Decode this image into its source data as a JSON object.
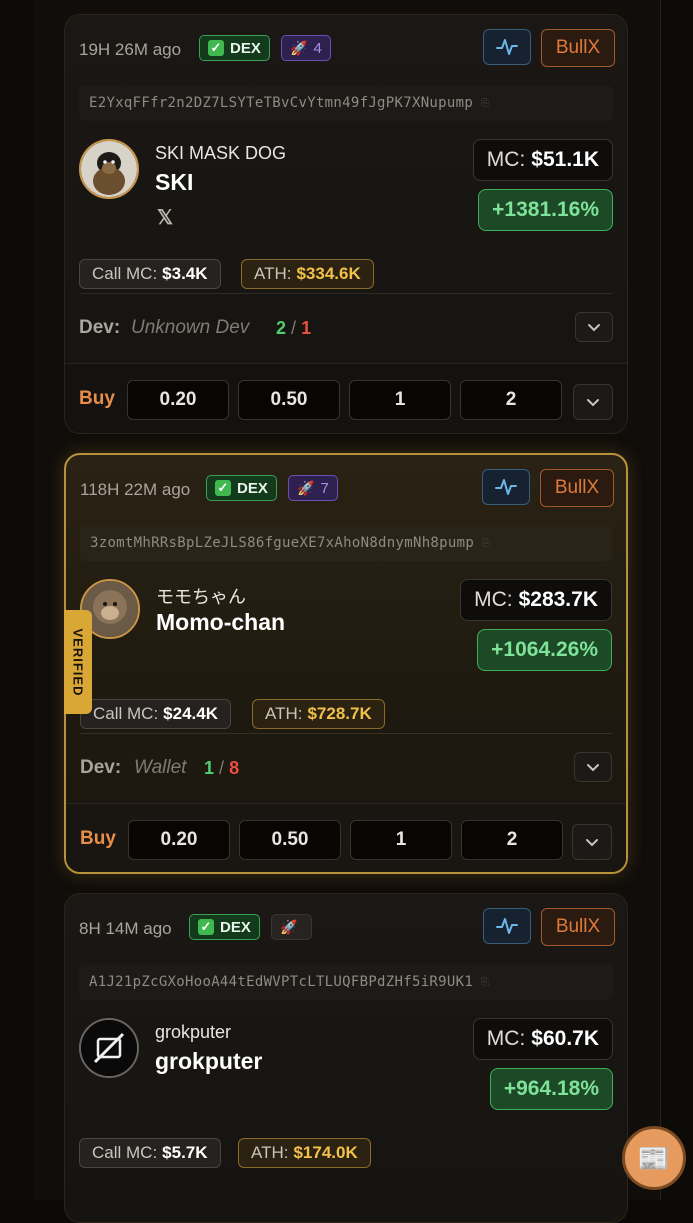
{
  "cards": [
    {
      "age": "19H 26M ago",
      "dex": "DEX",
      "rocket_count": "4",
      "bullx": "BullX",
      "address": "E2YxqFFfr2n2DZ7LSYTeTBvCvYtmn49fJgPK7XNupump",
      "name": "SKI MASK DOG",
      "symbol": "SKI",
      "mc_label": "MC:",
      "mc_value": "$51.1K",
      "change": "+1381.16%",
      "call_label": "Call MC:",
      "call_value": "$3.4K",
      "ath_label": "ATH:",
      "ath_value": "$334.6K",
      "dev_label": "Dev:",
      "dev_name": "Unknown Dev",
      "dev_good": "2",
      "dev_sep": "/",
      "dev_bad": "1",
      "buy_label": "Buy",
      "amounts": [
        "0.20",
        "0.50",
        "1",
        "2"
      ]
    },
    {
      "age": "118H 22M ago",
      "dex": "DEX",
      "rocket_count": "7",
      "bullx": "BullX",
      "address": "3zomtMhRRsBpLZeJLS86fgueXE7xAhoN8dnymNh8pump",
      "name": "モモちゃん",
      "symbol": "Momo-chan",
      "mc_label": "MC:",
      "mc_value": "$283.7K",
      "change": "+1064.26%",
      "call_label": "Call MC:",
      "call_value": "$24.4K",
      "ath_label": "ATH:",
      "ath_value": "$728.7K",
      "dev_label": "Dev:",
      "dev_name": "Wallet",
      "dev_good": "1",
      "dev_sep": "/",
      "dev_bad": "8",
      "buy_label": "Buy",
      "amounts": [
        "0.20",
        "0.50",
        "1",
        "2"
      ],
      "verified_tag": "VERIFIED"
    },
    {
      "age": "8H 14M ago",
      "dex": "DEX",
      "rocket_count": "",
      "bullx": "BullX",
      "address": "A1J21pZcGXoHooA44tEdWVPTcLTLUQFBPdZHf5iR9UK1",
      "name": "grokputer",
      "symbol": "grokputer",
      "mc_label": "MC:",
      "mc_value": "$60.7K",
      "change": "+964.18%",
      "call_label": "Call MC:",
      "call_value": "$5.7K",
      "ath_label": "ATH:",
      "ath_value": "$174.0K"
    }
  ],
  "icons": {
    "x_logo": "x-logo-icon",
    "pulse": "activity-pulse-icon",
    "chevron": "chevron-down-icon",
    "check": "check-icon",
    "rocket": "rocket-icon",
    "copy": "copy-icon",
    "fab": "newspaper-icon"
  },
  "colors": {
    "accent_orange": "#e88d4a",
    "positive_green": "#4fcf6f",
    "negative_red": "#e9503f",
    "ath_gold": "#f2c14a",
    "verified_gold": "#d8a736"
  }
}
